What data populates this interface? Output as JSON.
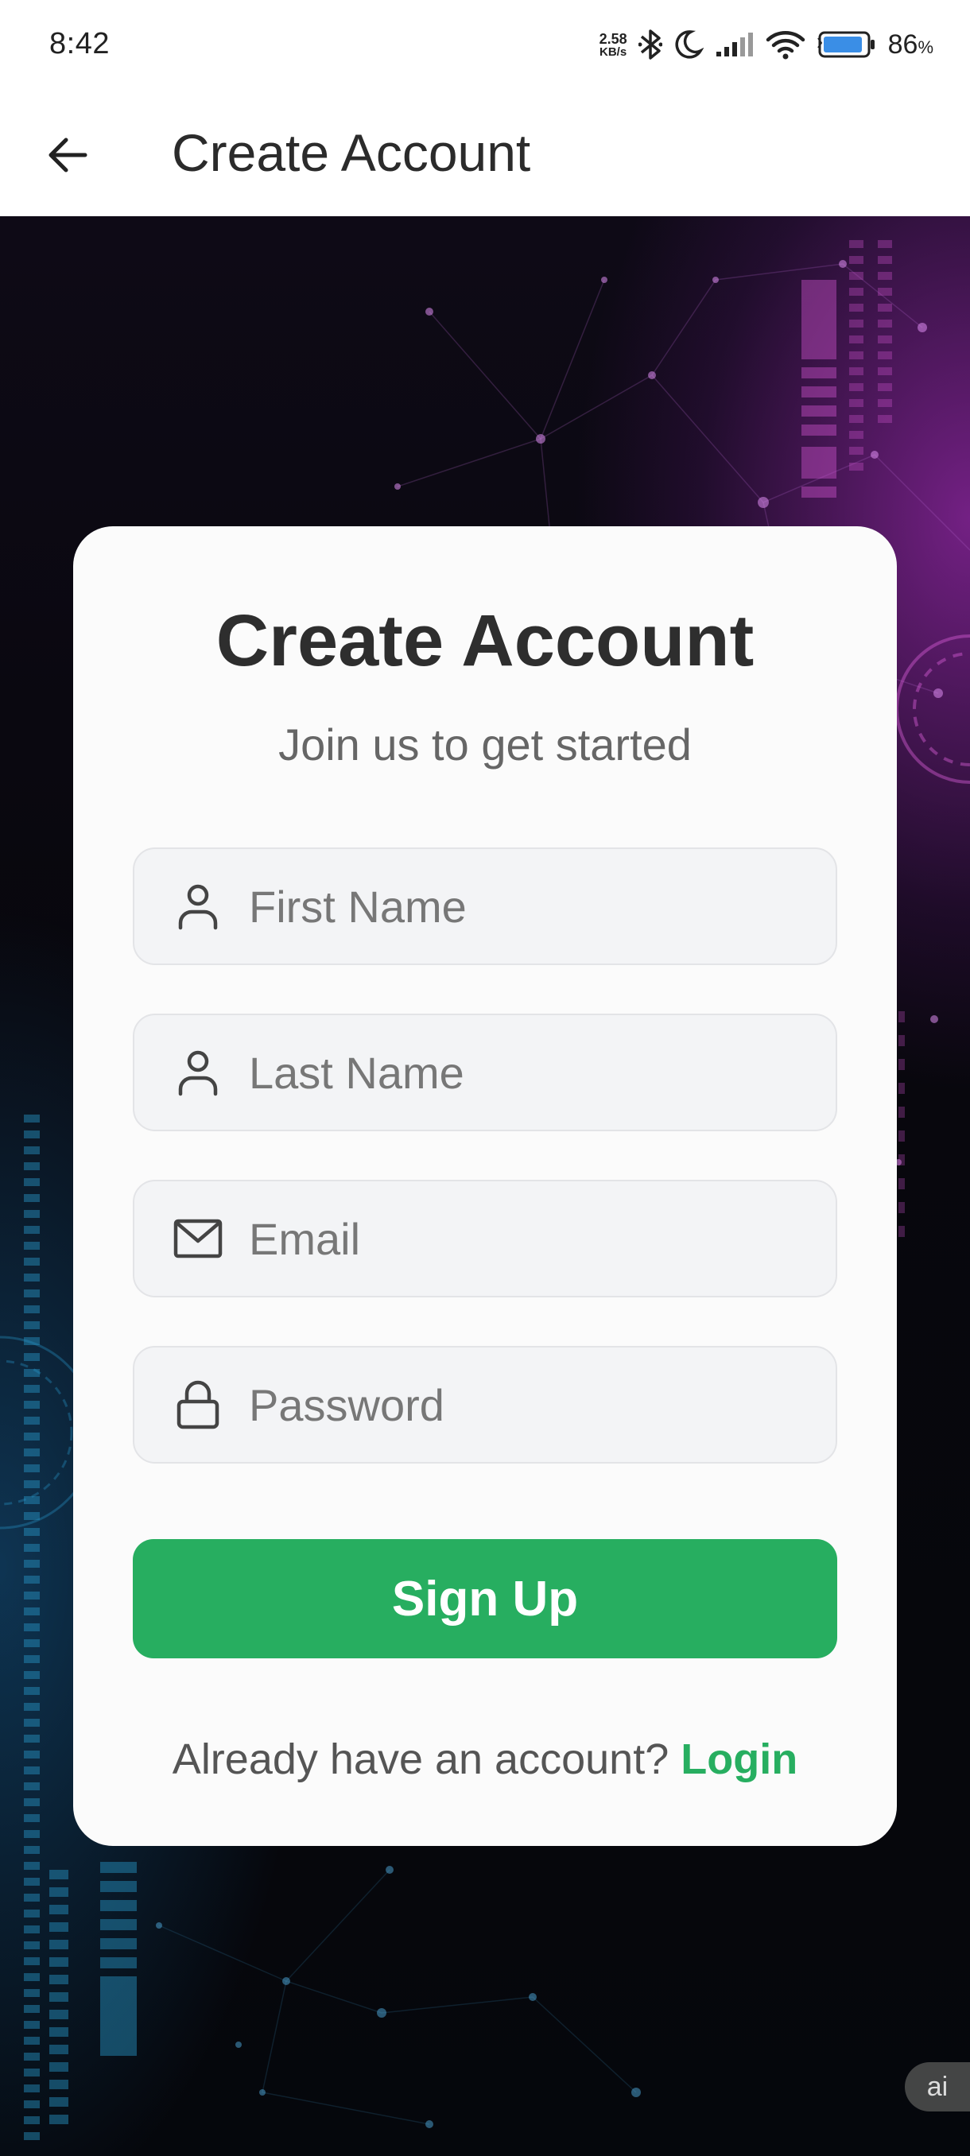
{
  "status_bar": {
    "time": "8:42",
    "net_speed_value": "2.58",
    "net_speed_unit": "KB/s",
    "battery_percent": "86",
    "battery_percent_sign": "%"
  },
  "app_bar": {
    "title": "Create Account",
    "back_icon": "arrow-left-icon"
  },
  "card": {
    "title": "Create Account",
    "subtitle": "Join us to get started",
    "fields": [
      {
        "placeholder": "First Name",
        "value": "",
        "icon": "person-icon"
      },
      {
        "placeholder": "Last Name",
        "value": "",
        "icon": "person-icon"
      },
      {
        "placeholder": "Email",
        "value": "",
        "icon": "mail-icon"
      },
      {
        "placeholder": "Password",
        "value": "",
        "icon": "lock-icon"
      }
    ],
    "signup_label": "Sign Up",
    "footer_prompt": "Already have an account? ",
    "login_label": "Login"
  },
  "ai_badge": "ai",
  "colors": {
    "accent": "#27ae60",
    "card_bg": "#fbfbfb",
    "field_bg": "#f3f4f6"
  }
}
